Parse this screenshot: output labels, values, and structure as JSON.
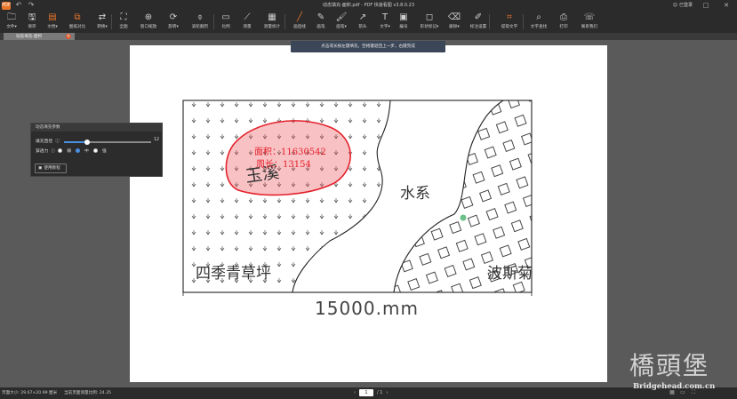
{
  "titlebar": {
    "app_logo": "PDF",
    "title": "动态填充-面积.pdf - PDF 快速看图 v3.8.0.23",
    "login": "已登录"
  },
  "toolbar": {
    "items": [
      {
        "label": "文件▾",
        "icon": "folder-icon"
      },
      {
        "label": "保存",
        "icon": "save-icon"
      },
      {
        "label": "文档▾",
        "icon": "document-icon",
        "orange": true
      },
      {
        "label": "图纸对比",
        "icon": "compare-icon",
        "orange": true
      },
      {
        "label": "转换▾",
        "icon": "convert-icon"
      },
      {
        "label": "全图",
        "icon": "fullview-icon"
      },
      {
        "label": "窗口缩放",
        "icon": "zoom-window-icon"
      },
      {
        "label": "旋转▾",
        "icon": "rotate-icon"
      },
      {
        "label": "滚轮翻页",
        "icon": "mouse-icon"
      },
      {
        "label": "比例",
        "icon": "scale-icon"
      },
      {
        "label": "测量",
        "icon": "measure-icon"
      },
      {
        "label": "测量统计",
        "icon": "measure-stats-icon"
      },
      {
        "label": "画直线",
        "icon": "line-icon",
        "orange": true
      },
      {
        "label": "画笔",
        "icon": "pen-icon"
      },
      {
        "label": "画笔▾",
        "icon": "brush-icon"
      },
      {
        "label": "箭头",
        "icon": "arrow-icon"
      },
      {
        "label": "文字▾",
        "icon": "text-icon"
      },
      {
        "label": "编号",
        "icon": "number-icon"
      },
      {
        "label": "形状标记▾",
        "icon": "shape-icon"
      },
      {
        "label": "删除▾",
        "icon": "eraser-icon"
      },
      {
        "label": "标注设置",
        "icon": "annotation-settings-icon"
      },
      {
        "label": "提取文字",
        "icon": "extract-text-icon",
        "orange": true
      },
      {
        "label": "文字查找",
        "icon": "search-icon"
      },
      {
        "label": "打印",
        "icon": "print-icon"
      },
      {
        "label": "联系我们",
        "icon": "headset-icon"
      }
    ]
  },
  "tab": {
    "label": "动态填充-面积"
  },
  "hint": "点击或长按左键填充，空格键退回上一步，右键完成",
  "panel": {
    "title": "动态填充参数",
    "fill_radius_label": "填充直径",
    "fill_radius_value": "12",
    "fill_radius_fraction": 0.27,
    "tolerance_label": "穿透力",
    "tolerance_options": [
      "弱",
      "中",
      "强"
    ],
    "tolerance_selected": "中",
    "tutorial_button": "使用教程"
  },
  "drawing": {
    "area_label": "面积：11630542",
    "perimeter_label": "周长：13154",
    "region_yuxiang": "玉溪",
    "region_water": "水系",
    "region_bosijv": "波斯菊",
    "region_siji": "四季青草坪",
    "dimension": "15000.mm",
    "highlight_color": "#e3212b"
  },
  "statusbar": {
    "page_size": "页面大小: 29.67×20.99 厘米",
    "scale": "当前页面测量比例: 24.35",
    "current_page": "1",
    "total_pages": "/ 1"
  },
  "watermark": {
    "title": "橋頭堡",
    "url": "Bridgehead.com.cn"
  }
}
